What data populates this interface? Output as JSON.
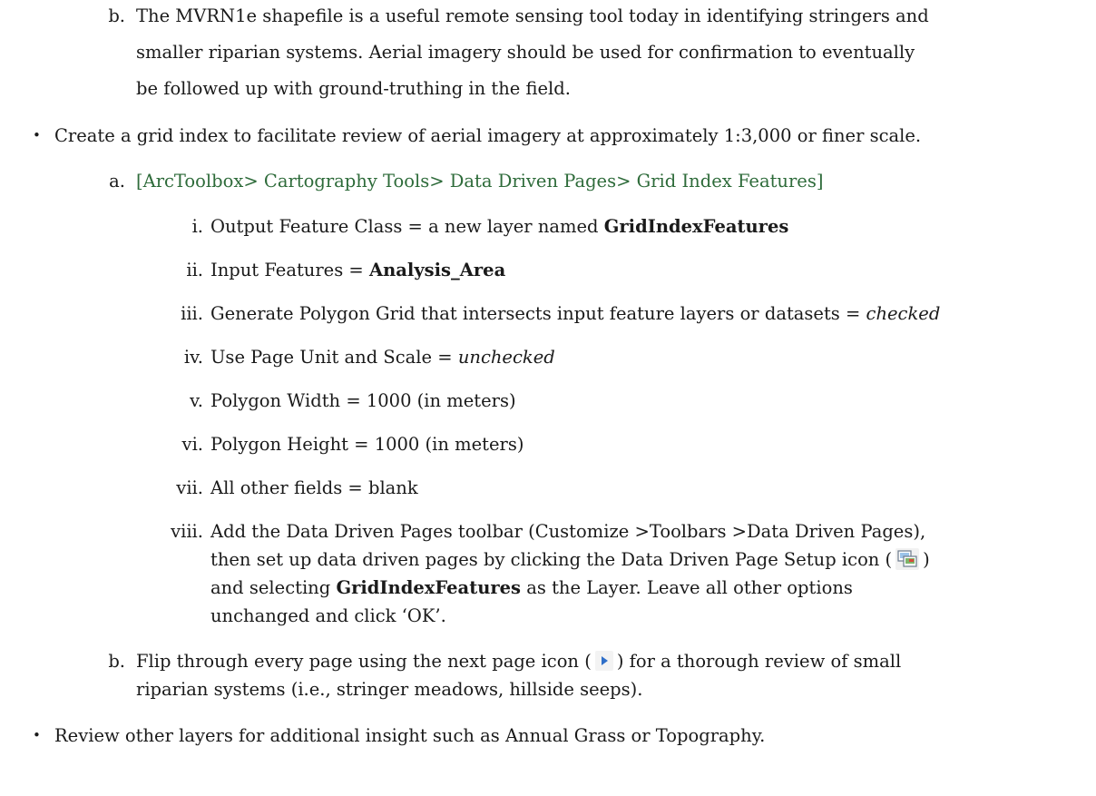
{
  "top_item": {
    "marker": "b.",
    "lines": [
      "The MVRN1e shapefile is a useful remote sensing tool today in identifying stringers and",
      "smaller riparian systems. Aerial imagery should be used for confirmation to eventually",
      "be followed up with ground-truthing in the field."
    ]
  },
  "bullet1": {
    "symbol": "•",
    "text": "Create a grid index to facilitate review of aerial imagery at approximately 1:3,000 or finer scale."
  },
  "item_a": {
    "marker": "a.",
    "path": "[ArcToolbox> Cartography Tools> Data Driven Pages> Grid Index Features]"
  },
  "sub_items": [
    {
      "marker": "i.",
      "pre": "Output Feature Class = a new layer named ",
      "bold": "GridIndexFeatures",
      "post": ""
    },
    {
      "marker": "ii.",
      "pre": "Input Features = ",
      "bold": "Analysis_Area",
      "post": ""
    },
    {
      "marker": "iii.",
      "pre": "Generate Polygon Grid that intersects input feature layers or datasets = ",
      "italic": "checked"
    },
    {
      "marker": "iv.",
      "pre": "Use Page Unit and Scale = ",
      "italic": "unchecked"
    },
    {
      "marker": "v.",
      "pre": "Polygon Width = 1000 (in meters)"
    },
    {
      "marker": "vi.",
      "pre": "Polygon Height = 1000 (in meters)"
    },
    {
      "marker": "vii.",
      "pre": "All other fields = blank"
    }
  ],
  "item_viii": {
    "marker": "viii.",
    "line1": "Add the Data Driven Pages toolbar (Customize >Toolbars >Data Driven Pages),",
    "line2_pre": "then set up data driven pages by clicking the Data Driven Page Setup icon (",
    "line2_post": ")",
    "line3_pre": "and selecting ",
    "line3_bold": "GridIndexFeatures",
    "line3_post": " as the Layer. Leave all other options",
    "line4": "unchanged and click ‘OK’.",
    "icon": "data-driven-page-setup-icon"
  },
  "item_b2": {
    "marker": "b.",
    "line1_pre": "Flip through every page using the next page icon (",
    "line1_post": ") for a thorough review of small",
    "line2": "riparian systems (i.e., stringer meadows, hillside seeps).",
    "icon": "next-page-icon"
  },
  "bullet2": {
    "symbol": "•",
    "text": "Review other layers for additional insight such as Annual Grass or Topography."
  },
  "colors": {
    "link": "#2e6b3a",
    "text": "#1a1a1a",
    "icon_blue": "#2f6fc9"
  }
}
